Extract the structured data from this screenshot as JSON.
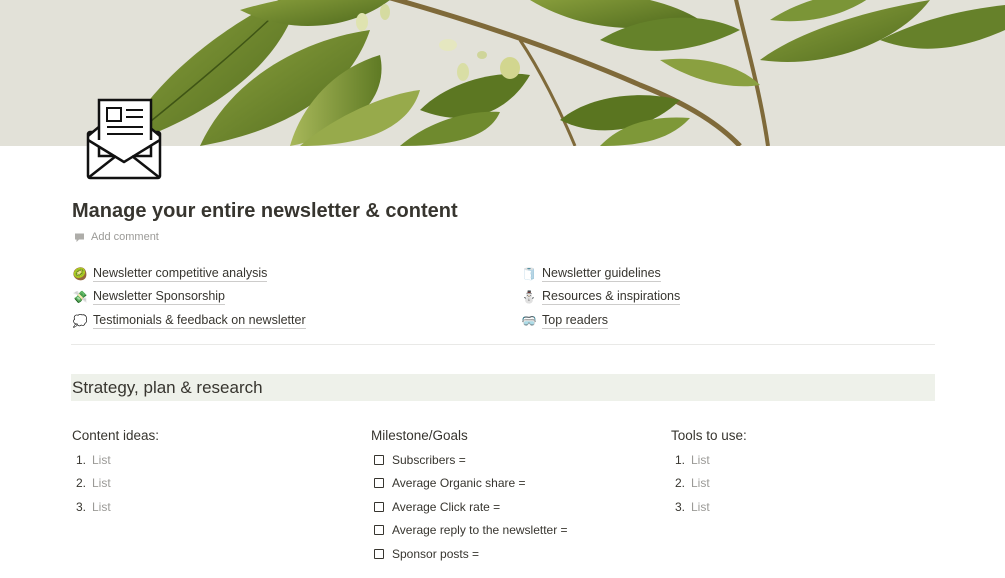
{
  "page": {
    "title": "Manage your entire newsletter & content",
    "add_comment": "Add comment",
    "icon": "newsletter-envelope-icon"
  },
  "links": {
    "left": [
      {
        "emoji": "🥝",
        "label": "Newsletter competitive analysis"
      },
      {
        "emoji": "💸",
        "label": "Newsletter Sponsorship"
      },
      {
        "emoji": "💭",
        "label": "Testimonials & feedback on newsletter"
      }
    ],
    "right": [
      {
        "emoji": "🧻",
        "label": "Newsletter guidelines"
      },
      {
        "emoji": "⛄",
        "label": "Resources & inspirations"
      },
      {
        "emoji": "🥽",
        "label": "Top readers"
      }
    ]
  },
  "section": {
    "heading": "Strategy, plan & research"
  },
  "columns": {
    "content_ideas": {
      "title": "Content ideas:",
      "items": [
        {
          "num": "1.",
          "text": "List"
        },
        {
          "num": "2.",
          "text": "List"
        },
        {
          "num": "3.",
          "text": "List"
        }
      ]
    },
    "milestones": {
      "title": "Milestone/Goals",
      "items": [
        {
          "text": "Subscribers =",
          "checked": false
        },
        {
          "text": "Average Organic share =",
          "checked": false
        },
        {
          "text": "Average Click rate =",
          "checked": false
        },
        {
          "text": "Average reply to the newsletter =",
          "checked": false
        },
        {
          "text": "Sponsor posts =",
          "checked": false
        }
      ]
    },
    "tools": {
      "title": "Tools to use:",
      "items": [
        {
          "num": "1.",
          "text": "List"
        },
        {
          "num": "2.",
          "text": "List"
        },
        {
          "num": "3.",
          "text": "List"
        }
      ]
    }
  },
  "colors": {
    "text": "#37352f",
    "muted": "#9b9a97",
    "heading_bg": "#eef1ea",
    "cover_bg": "#e2e1d8",
    "leaf": "#6f8a2e"
  }
}
